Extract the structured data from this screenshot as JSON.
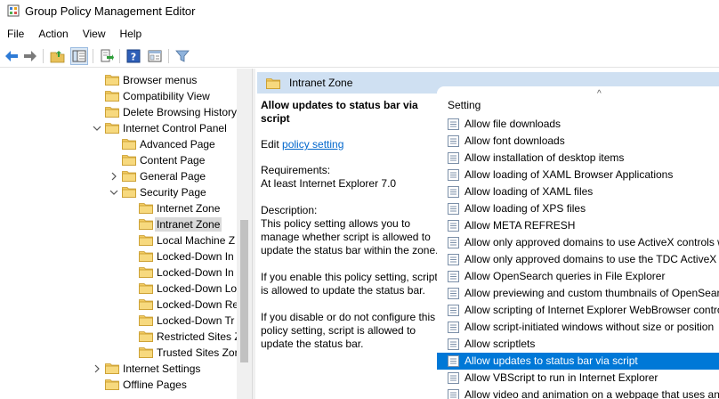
{
  "window": {
    "title": "Group Policy Management Editor"
  },
  "menu": [
    "File",
    "Action",
    "View",
    "Help"
  ],
  "toolbar": [
    "back-icon",
    "forward-icon",
    "up-folder-icon",
    "show-hide-tree-icon",
    "export-list-icon",
    "help-icon",
    "properties-icon",
    "filter-icon"
  ],
  "tree": {
    "items": [
      {
        "label": "Browser menus",
        "depth": 1,
        "arrow": "none"
      },
      {
        "label": "Compatibility View",
        "depth": 1,
        "arrow": "none"
      },
      {
        "label": "Delete Browsing History",
        "depth": 1,
        "arrow": "none"
      },
      {
        "label": "Internet Control Panel",
        "depth": 1,
        "arrow": "expanded"
      },
      {
        "label": "Advanced Page",
        "depth": 2,
        "arrow": "none"
      },
      {
        "label": "Content Page",
        "depth": 2,
        "arrow": "none"
      },
      {
        "label": "General Page",
        "depth": 2,
        "arrow": "collapsed"
      },
      {
        "label": "Security Page",
        "depth": 2,
        "arrow": "expanded"
      },
      {
        "label": "Internet Zone",
        "depth": 3,
        "arrow": "none"
      },
      {
        "label": "Intranet Zone",
        "depth": 3,
        "arrow": "none",
        "selected": true
      },
      {
        "label": "Local Machine Z",
        "depth": 3,
        "arrow": "none"
      },
      {
        "label": "Locked-Down In",
        "depth": 3,
        "arrow": "none"
      },
      {
        "label": "Locked-Down In",
        "depth": 3,
        "arrow": "none"
      },
      {
        "label": "Locked-Down Lo",
        "depth": 3,
        "arrow": "none"
      },
      {
        "label": "Locked-Down Re",
        "depth": 3,
        "arrow": "none"
      },
      {
        "label": "Locked-Down Tr",
        "depth": 3,
        "arrow": "none"
      },
      {
        "label": "Restricted Sites Z",
        "depth": 3,
        "arrow": "none"
      },
      {
        "label": "Trusted Sites Zor",
        "depth": 3,
        "arrow": "none"
      },
      {
        "label": "Internet Settings",
        "depth": 1,
        "arrow": "collapsed"
      },
      {
        "label": "Offline Pages",
        "depth": 1,
        "arrow": "none"
      }
    ]
  },
  "zone_header": {
    "title": "Intranet Zone"
  },
  "description": {
    "heading": "Allow updates to status bar via script",
    "edit_prefix": "Edit ",
    "edit_link": "policy setting ",
    "requirements_label": "Requirements:",
    "requirements_value": "At least Internet Explorer 7.0",
    "description_label": "Description:",
    "paragraph1": "This policy setting allows you to manage whether script is allowed to update the status bar within the zone.",
    "paragraph2": "If you enable this policy setting, script is allowed to update the status bar.",
    "paragraph3": "If you disable or do not configure this policy setting, script is allowed to update the status bar."
  },
  "list": {
    "column_header": "Setting",
    "sort_indicator": "^",
    "items": [
      "Allow file downloads",
      "Allow font downloads",
      "Allow installation of desktop items",
      "Allow loading of XAML Browser Applications",
      "Allow loading of XAML files",
      "Allow loading of XPS files",
      "Allow META REFRESH",
      "Allow only approved domains to use ActiveX controls w",
      "Allow only approved domains to use the TDC ActiveX c",
      "Allow OpenSearch queries in File Explorer",
      "Allow previewing and custom thumbnails of OpenSear",
      "Allow scripting of Internet Explorer WebBrowser contro",
      "Allow script-initiated windows without size or position",
      "Allow scriptlets",
      "Allow updates to status bar via script",
      "Allow VBScript to run in Internet Explorer",
      "Allow video and animation on a webpage that uses an"
    ],
    "selected_index": 14
  }
}
